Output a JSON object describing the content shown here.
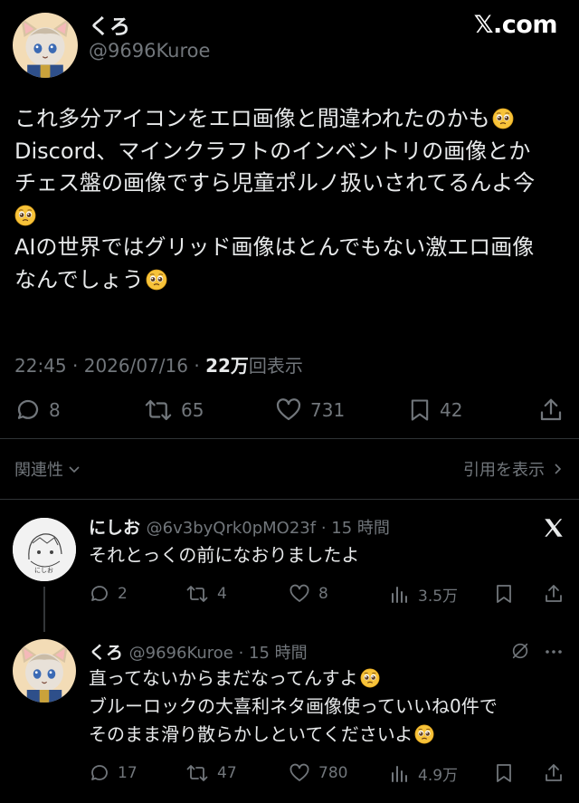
{
  "main_tweet": {
    "display_name": "くろ",
    "handle": "@9696Kuroe",
    "watermark": "𝕏.com",
    "text_lines": [
      "これ多分アイコンをエロ画像と間違われたのかも",
      "Discord、マインクラフトのインベントリの画像とか",
      "チェス盤の画像ですら児童ポルノ扱いされてるんよ今",
      "",
      "AIの世界ではグリッド画像はとんでもない激エロ画像",
      "なんでしょう"
    ],
    "time": "22:45",
    "date": "2026/07/16",
    "views_count": "22万",
    "views_label": "回表示",
    "actions": {
      "replies": "8",
      "retweets": "65",
      "likes": "731",
      "bookmarks": "42"
    },
    "related_label": "関連性",
    "quotes_label": "引用を表示"
  },
  "replies": [
    {
      "display_name": "にしお",
      "handle": "@6v3byQrk0pMO23f",
      "time": "15 時間",
      "text_lines": [
        "それとっくの前になおりましたよ"
      ],
      "actions": {
        "replies": "2",
        "retweets": "4",
        "likes": "8",
        "views": "3.5万"
      }
    },
    {
      "display_name": "くろ",
      "handle": "@9696Kuroe",
      "time": "15 時間",
      "text_lines": [
        "直ってないからまだなってんすよ",
        "ブルーロックの大喜利ネタ画像使っていいね0件で",
        "そのまま滑り散らかしといてくださいよ"
      ],
      "actions": {
        "replies": "17",
        "retweets": "47",
        "likes": "780",
        "views": "4.9万"
      }
    }
  ],
  "icons": {
    "reply": "speech-bubble-icon",
    "retweet": "retweet-icon",
    "like": "heart-icon",
    "bookmark": "bookmark-icon",
    "share": "share-icon",
    "views": "bar-chart-icon",
    "emoji": "pleading-face-emoji",
    "x_logo": "x-logo-icon",
    "grok": "grok-icon",
    "more": "more-dots-icon"
  },
  "colors": {
    "background": "#000000",
    "text": "#e7e9ea",
    "muted": "#71767b",
    "divider": "#2f3336"
  }
}
